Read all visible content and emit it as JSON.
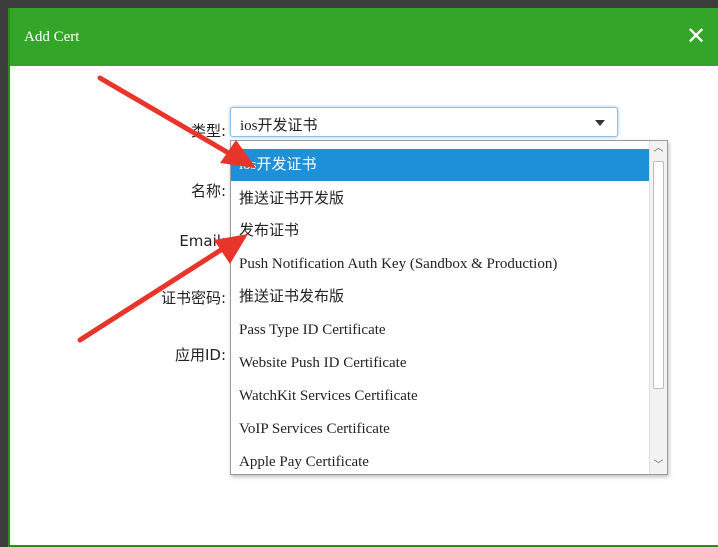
{
  "dialog": {
    "title": "Add Cert",
    "close_label": "✕"
  },
  "form": {
    "labels": {
      "type": "类型:",
      "name": "名称:",
      "email": "Email:",
      "cert_password": "证书密码:",
      "app_id": "应用ID:"
    },
    "type_select": {
      "value": "ios开发证书",
      "options": [
        "ios开发证书",
        "推送证书开发版",
        "发布证书",
        "Push Notification Auth Key (Sandbox & Production)",
        "推送证书发布版",
        "Pass Type ID Certificate",
        "Website Push ID Certificate",
        "WatchKit Services Certificate",
        "VoIP Services Certificate",
        "Apple Pay Certificate"
      ],
      "selected_index": 0
    }
  },
  "colors": {
    "titlebar": "#33a528",
    "selected_option": "#1e90d8",
    "annotation_arrow": "#e8352b"
  },
  "icons": {
    "close": "close-icon",
    "dropdown_arrow": "chevron-down-icon",
    "scroll_up": "chevron-up-icon",
    "scroll_down": "chevron-down-icon"
  }
}
